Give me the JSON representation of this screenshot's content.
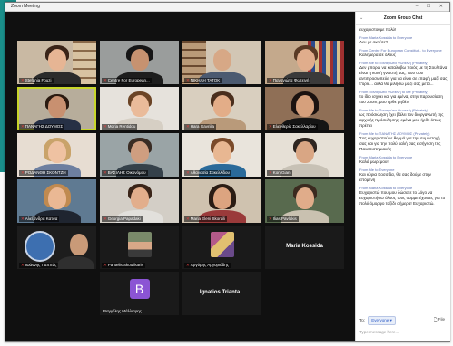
{
  "window": {
    "title": "Zoom Meeting",
    "controls": "– ☐ ✕"
  },
  "tiles": [
    {
      "name": "Stefania Fouzi"
    },
    {
      "name": "Centre For European..."
    },
    {
      "name": "ΝΙΚΗΛΗ ΤΑΤΟΚ"
    },
    {
      "name": "Παναγιώτα Φωτεινή"
    },
    {
      "name": "ΠΑΝΑΓΗΣ ΔΟΥΜΟΣ"
    },
    {
      "name": "Μαria Rentidou"
    },
    {
      "name": "Hara Gavriila"
    },
    {
      "name": "Ελευθερία Σακελλαρίου"
    },
    {
      "name": "ΡΟΔΑΝΘΗ ΣΚΟΝΤΖΗ"
    },
    {
      "name": "ΒΑΣΙΛΗΣ Οικονόμου"
    },
    {
      "name": "Αθανασία Σακελλίδου"
    },
    {
      "name": "Kon Gian"
    },
    {
      "name": "Αλεξάνδρα Κατσα"
    },
    {
      "name": "Georgia Papadaki"
    },
    {
      "name": "Maria Eleni Skordili"
    },
    {
      "name": "Ilias Pavlakis"
    },
    {
      "name": "Ιωάννης Παππάς"
    },
    {
      "name": "Pantelis Skoulikaris"
    },
    {
      "name": "Αργύρης Αργυριάδης"
    },
    {
      "name": "Maria Kossida"
    },
    {
      "name": "Βαγγέλης Μάλλιαρης",
      "initial": "B"
    },
    {
      "name": "Ignatios Trianta..."
    }
  ],
  "chat": {
    "title": "Zoom Group Chat",
    "messages": [
      {
        "from": "",
        "text": "ευχαριστούμε πολύ!"
      },
      {
        "from": "From Maria Kossida to Everyone",
        "text": "Δεν με ακούτε?"
      },
      {
        "from": "From Centre For European Constitut... to Everyone",
        "text": "Καλημέρα σε όλους"
      },
      {
        "from": "From Me to Παναγιώτα Φωτεινή (Privately)",
        "text": "Δεν μπορώ να καταλάβω ποιός με τη Σουλτάνα είναι η κοινή γνωστή μας, που σου αντιπροσωπεύει για να είναι σε επαφή μαζί σας τ'ορίς... αλλά θα μιλήσω μαζί σας μετά..."
      },
      {
        "from": "From Παναγιώτα Φωτεινή to Me (Privately)",
        "text": "το ίδιο ισχύει και για εμένα, στην παρουσίαση του zoom, μου ήρθε μηδέν!"
      },
      {
        "from": "From Me to Παναγιώτα Φωτεινή (Privately)",
        "text": "ως πρόσκληση έχει βάλει τον διοργανωτή της αρχικής πρόσκλησης, εμένα μου ήρθε όπως πρέπει"
      },
      {
        "from": "From Me to ΠΑΝΑΓΗΣ ΔΟΥΜΟΣ (Privately)",
        "text": "Σας ευχαριστούμε θερμά για την συμμετοχή σας και για την πολύ καλή σας εισήγηση της Πανεπιστημιακής"
      },
      {
        "from": "From Maria Kossida to Everyone",
        "text": "Καλά μωρέμου!"
      },
      {
        "from": "From Me to Everyone",
        "text": "Και κύρια Κοσσίδα, θα σας δούμε στην επόμενη"
      },
      {
        "from": "From Maria Kossida to Everyone",
        "text": "Ευχαριστώ που μου δώσατε το λόγο να ευχαριστήσω όλους τους συμμετέχοντες για το πολύ όμορφο ταξίδι σήμερα! Ευχαριστώ."
      }
    ],
    "to_label": "To:",
    "recipient": "Everyone",
    "file_label": "File",
    "placeholder": "Type message here..."
  }
}
